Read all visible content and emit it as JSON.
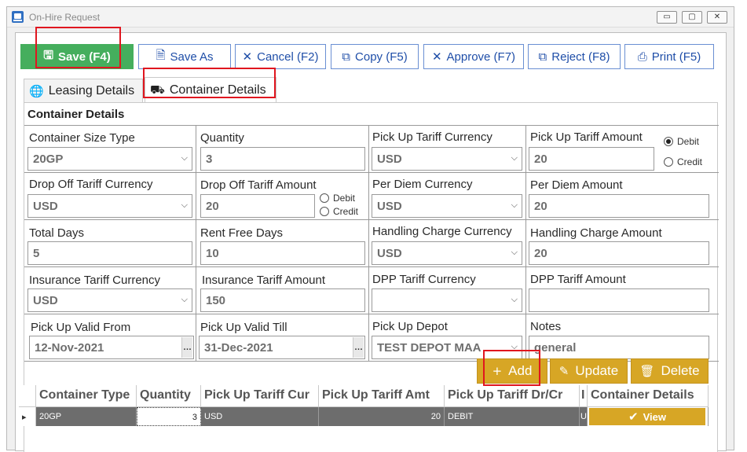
{
  "window": {
    "title": "On-Hire Request",
    "controls": {
      "minimize": "▭",
      "maximize": "▢",
      "close": "✕"
    }
  },
  "toolbar": {
    "save_label": "Save (F4)",
    "save_as_label": "Save As",
    "cancel_label": "Cancel (F2)",
    "copy_label": "Copy (F5)",
    "approve_label": "Approve (F7)",
    "reject_label": "Reject (F8)",
    "print_label": "Print (F5)"
  },
  "tabs": [
    {
      "label": "Leasing Details",
      "icon": "globe-icon"
    },
    {
      "label": "Container Details",
      "icon": "truck-icon"
    }
  ],
  "panel": {
    "title": "Container Details",
    "fields": {
      "container_size_type": {
        "label": "Container Size Type",
        "value": "20GP"
      },
      "quantity": {
        "label": "Quantity",
        "value": "3"
      },
      "pickup_tariff_currency": {
        "label": "Pick Up Tariff Currency",
        "value": "USD"
      },
      "pickup_tariff_amount": {
        "label": "Pick Up Tariff Amount",
        "value": "20"
      },
      "dropoff_tariff_currency": {
        "label": "Drop Off Tariff Currency",
        "value": "USD"
      },
      "dropoff_tariff_amount": {
        "label": "Drop Off Tariff Amount",
        "value": "20"
      },
      "per_diem_currency": {
        "label": "Per Diem Currency",
        "value": "USD"
      },
      "per_diem_amount": {
        "label": "Per Diem Amount",
        "value": "20"
      },
      "total_days": {
        "label": "Total Days",
        "value": "5"
      },
      "rent_free_days": {
        "label": "Rent Free Days",
        "value": "10"
      },
      "handling_charge_currency": {
        "label": "Handling Charge Currency",
        "value": "USD"
      },
      "handling_charge_amount": {
        "label": "Handling Charge Amount",
        "value": "20"
      },
      "insurance_tariff_currency": {
        "label": "Insurance Tariff Currency",
        "value": "USD"
      },
      "insurance_tariff_amount": {
        "label": "Insurance Tariff Amount",
        "value": "150"
      },
      "dpp_tariff_currency": {
        "label": "DPP Tariff Currency",
        "value": ""
      },
      "dpp_tariff_amount": {
        "label": "DPP Tariff Amount",
        "value": ""
      },
      "pickup_valid_from": {
        "label": "Pick Up Valid From",
        "value": "12-Nov-2021"
      },
      "pickup_valid_till": {
        "label": "Pick Up Valid Till",
        "value": "31-Dec-2021"
      },
      "pickup_depot": {
        "label": "Pick Up Depot",
        "value": "TEST DEPOT MAA"
      },
      "notes": {
        "label": "Notes",
        "value": "general"
      }
    },
    "radios": {
      "debit": "Debit",
      "credit": "Credit"
    }
  },
  "actions": {
    "add_label": "Add",
    "update_label": "Update",
    "delete_label": "Delete"
  },
  "table": {
    "headers": [
      "Container Type",
      "Quantity",
      "Pick Up Tariff Cur",
      "Pick Up Tariff Amt",
      "Pick Up Tariff Dr/Cr",
      "I",
      "Container Details"
    ],
    "rows": [
      {
        "container_type": "20GP",
        "quantity": "3",
        "tariff_cur": "USD",
        "tariff_amt": "20",
        "dr_cr": "DEBIT",
        "extra": "U",
        "details_label": "View"
      }
    ]
  },
  "colors": {
    "save_green": "#45ae5d",
    "action_gold": "#d7a625",
    "toolbar_blue": "#1f4ea8",
    "highlight_red": "#e0161f"
  }
}
